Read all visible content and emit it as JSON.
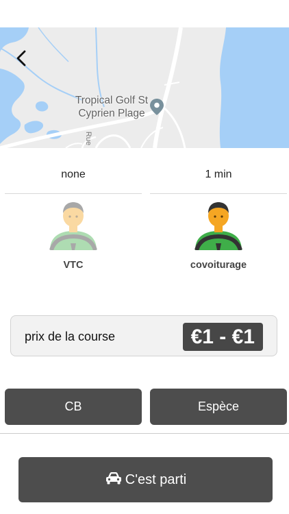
{
  "map": {
    "place_label_line1": "Tropical Golf St",
    "place_label_line2": "Cyprien Plage",
    "street_label": "Rue"
  },
  "options": [
    {
      "time": "none",
      "label": "VTC",
      "selected": false,
      "icon": "driver-avatar-icon"
    },
    {
      "time": "1 min",
      "label": "covoiturage",
      "selected": true,
      "icon": "driver-avatar-icon"
    }
  ],
  "price": {
    "label": "prix de la course",
    "value": "€1 - €1"
  },
  "payment": {
    "cb_label": "CB",
    "cash_label": "Espèce"
  },
  "confirm": {
    "label": "C'est parti",
    "icon": "car-icon"
  },
  "colors": {
    "button_bg": "#4d4d4d",
    "water": "#a5cff7",
    "driver_shirt": "#3fae49",
    "driver_skin": "#f5a623"
  }
}
